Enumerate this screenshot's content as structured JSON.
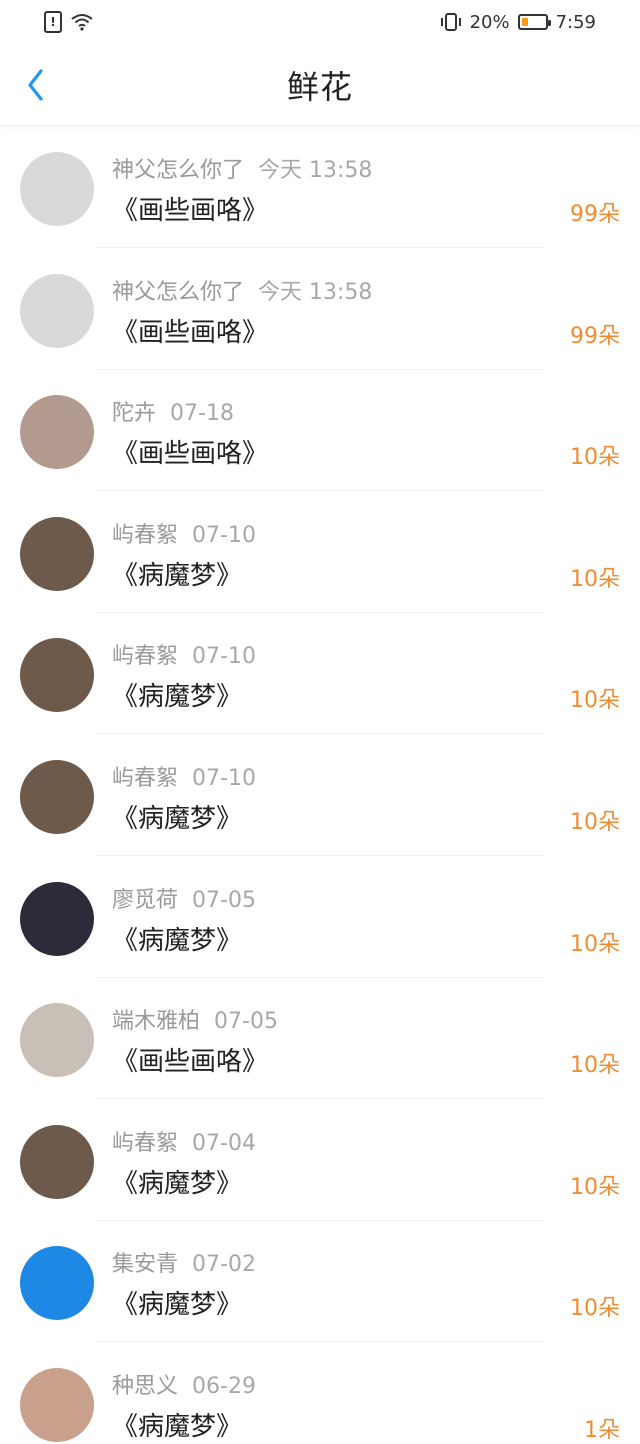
{
  "status_bar": {
    "battery": "20%",
    "time": "7:59"
  },
  "header": {
    "title": "鲜花"
  },
  "items": [
    {
      "name": "神父怎么你了",
      "time": "今天 13:58",
      "work": "《画些画咯》",
      "count": "99朵",
      "avatar_color": "#d9d9d9"
    },
    {
      "name": "神父怎么你了",
      "time": "今天 13:58",
      "work": "《画些画咯》",
      "count": "99朵",
      "avatar_color": "#d9d9d9"
    },
    {
      "name": "陀卉",
      "time": "07-18",
      "work": "《画些画咯》",
      "count": "10朵",
      "avatar_color": "#b39a8f"
    },
    {
      "name": "屿春絮",
      "time": "07-10",
      "work": "《病魔梦》",
      "count": "10朵",
      "avatar_color": "#6e5a4a"
    },
    {
      "name": "屿春絮",
      "time": "07-10",
      "work": "《病魔梦》",
      "count": "10朵",
      "avatar_color": "#6e5a4a"
    },
    {
      "name": "屿春絮",
      "time": "07-10",
      "work": "《病魔梦》",
      "count": "10朵",
      "avatar_color": "#6e5a4a"
    },
    {
      "name": "廖觅荷",
      "time": "07-05",
      "work": "《病魔梦》",
      "count": "10朵",
      "avatar_color": "#2b2b3a"
    },
    {
      "name": "端木雅柏",
      "time": "07-05",
      "work": "《画些画咯》",
      "count": "10朵",
      "avatar_color": "#c8c0b6"
    },
    {
      "name": "屿春絮",
      "time": "07-04",
      "work": "《病魔梦》",
      "count": "10朵",
      "avatar_color": "#6e5a4a"
    },
    {
      "name": "集安青",
      "time": "07-02",
      "work": "《病魔梦》",
      "count": "10朵",
      "avatar_color": "#1e88e5"
    },
    {
      "name": "种思义",
      "time": "06-29",
      "work": "《病魔梦》",
      "count": "1朵",
      "avatar_color": "#c9a08c"
    }
  ]
}
